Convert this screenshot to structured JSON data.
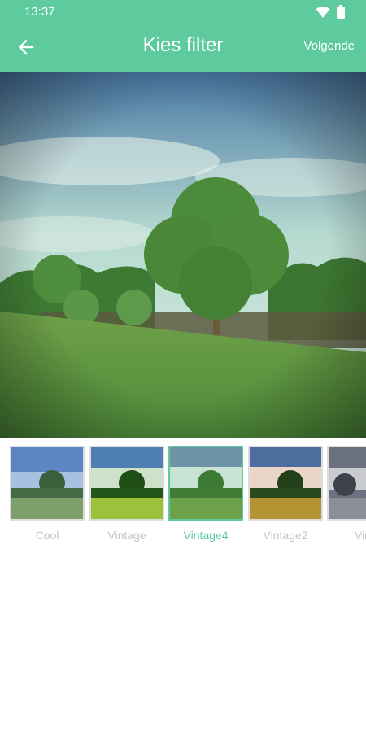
{
  "status_bar": {
    "time": "13:37",
    "icons": [
      "wifi-icon",
      "battery-icon"
    ]
  },
  "app_bar": {
    "title": "Kies filter",
    "back_icon": "arrow-left-icon",
    "next_label": "Volgende",
    "color": "#5ecb9e"
  },
  "filters": {
    "selected": "Vintage4",
    "items": [
      {
        "label": "Cool"
      },
      {
        "label": "Vintage"
      },
      {
        "label": "Vintage4"
      },
      {
        "label": "Vintage2"
      },
      {
        "label": "Vint"
      }
    ]
  }
}
